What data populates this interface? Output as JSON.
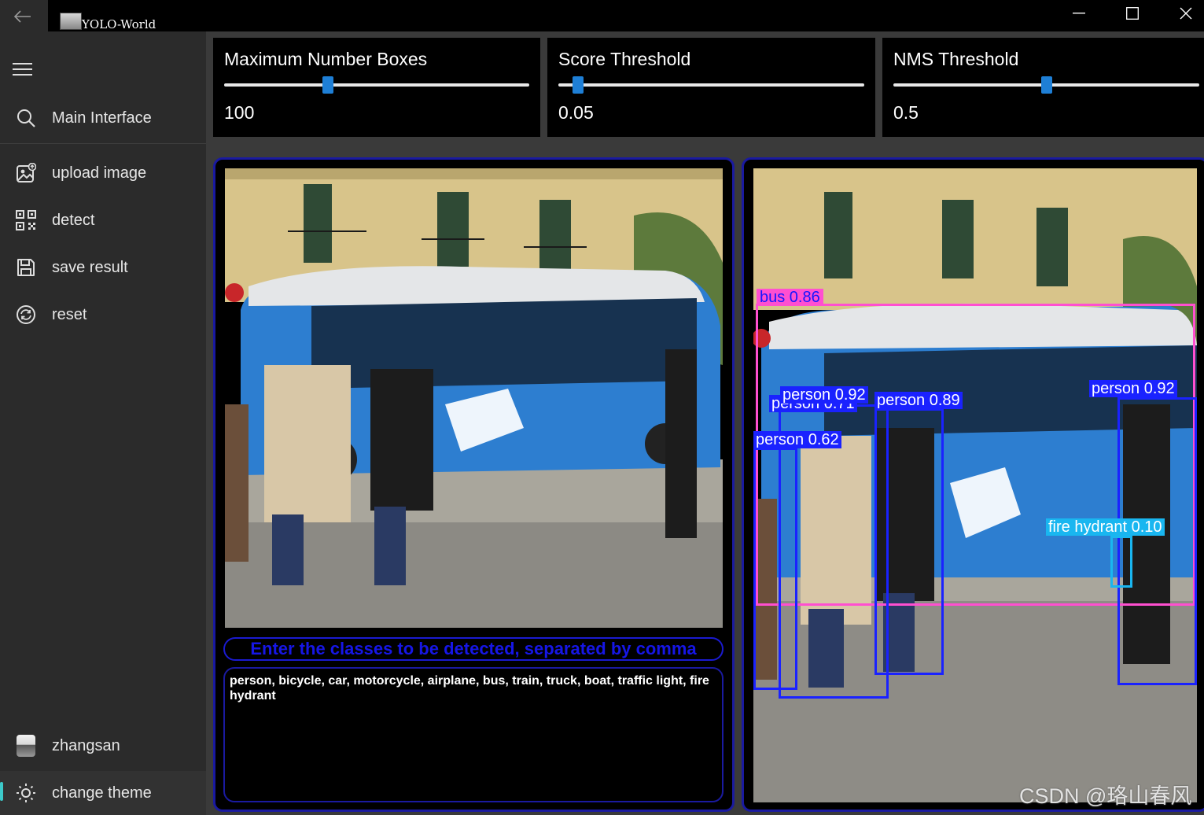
{
  "window": {
    "title": "YOLO-World"
  },
  "icons": {
    "back": "back-arrow-icon",
    "minimize": "minimize-icon",
    "maximize": "maximize-icon",
    "close": "close-icon",
    "menu": "hamburger-icon",
    "search": "search-icon",
    "upload": "image-upload-icon",
    "detect": "qr-scan-icon",
    "save": "save-icon",
    "reset": "sync-icon",
    "theme": "sun-icon"
  },
  "sidebar": {
    "main_interface": "Main Interface",
    "items": [
      {
        "label": "upload image"
      },
      {
        "label": "detect"
      },
      {
        "label": "save result"
      },
      {
        "label": "reset"
      }
    ],
    "user": "zhangsan",
    "theme": "change theme"
  },
  "sliders": [
    {
      "title": "Maximum Number Boxes",
      "value": "100",
      "fraction": 0.34
    },
    {
      "title": "Score Threshold",
      "value": "0.05",
      "fraction": 0.065
    },
    {
      "title": "NMS Threshold",
      "value": "0.5",
      "fraction": 0.5
    }
  ],
  "input_panel": {
    "prompt_label": "Enter the classes to be detected, separated by comma",
    "classes_text": "person, bicycle, car, motorcycle, airplane, bus, train, truck, boat, traffic light, fire hydrant"
  },
  "detections": {
    "bus": "bus 0.86",
    "person_1": "person 0.92",
    "person_2": "person 0.71",
    "person_3": "person 0.89",
    "person_4": "person 0.62",
    "person_5": "person 0.92",
    "hydrant": "fire hydrant 0.10"
  },
  "colors": {
    "accent_blue": "#1e7fd6",
    "panel_border": "#1a1aa0",
    "bus_box": "#ff4fd0",
    "person_box": "#1a22ff",
    "hydrant_box": "#19b6f0",
    "theme_indicator": "#3cc9c9"
  },
  "watermark": "CSDN @珞山春风"
}
